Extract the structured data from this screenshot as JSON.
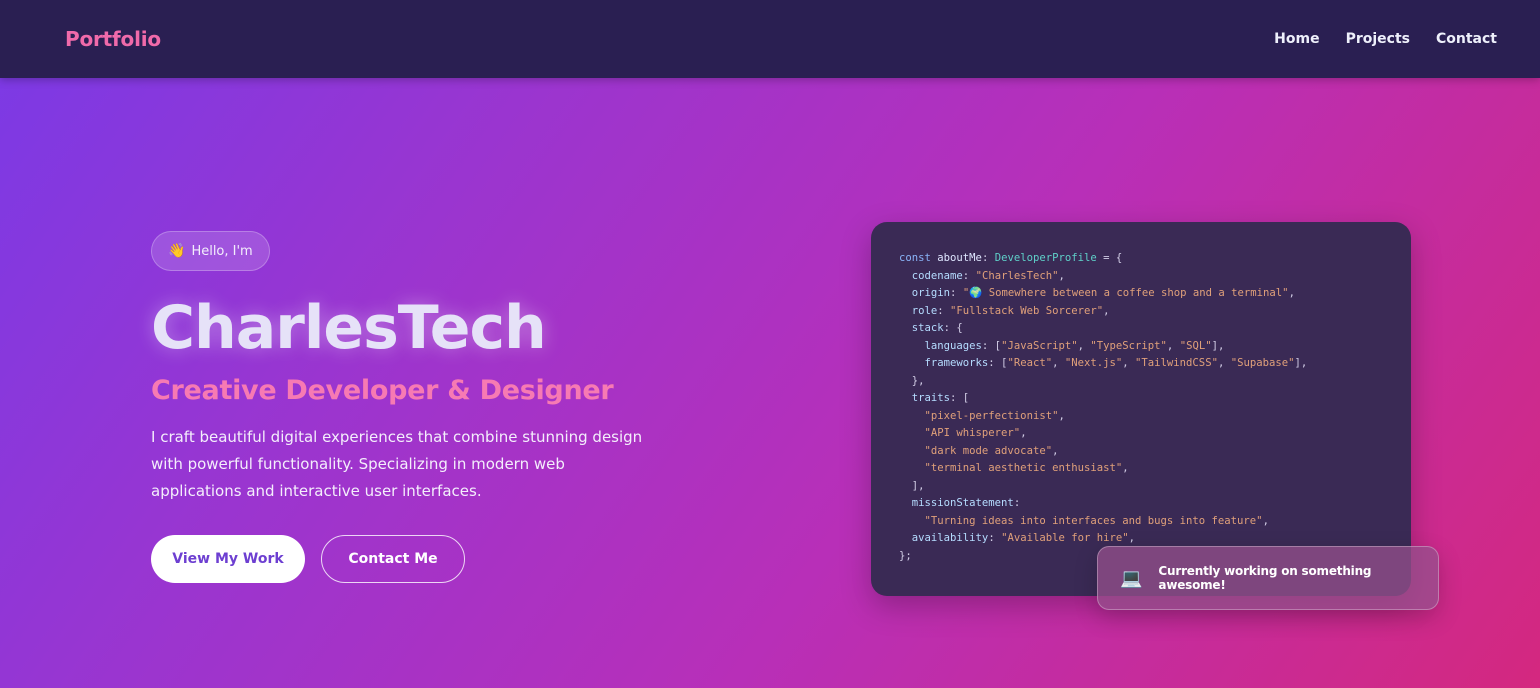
{
  "nav": {
    "logo": "Portfolio",
    "links": [
      {
        "label": "Home"
      },
      {
        "label": "Projects"
      },
      {
        "label": "Contact"
      }
    ]
  },
  "hero": {
    "greeting_icon": "👋",
    "greeting": "Hello, I'm",
    "name": "CharlesTech",
    "subtitle": "Creative Developer & Designer",
    "description": "I craft beautiful digital experiences that combine stunning design with powerful functionality. Specializing in modern web applications and interactive user interfaces.",
    "primary_button": "View My Work",
    "secondary_button": "Contact Me"
  },
  "code": {
    "line1": {
      "kw": "const",
      "id": "aboutMe",
      "ty": "DeveloperProfile",
      "end": " = {"
    },
    "codename": {
      "key": "codename",
      "value": "\"CharlesTech\""
    },
    "origin": {
      "key": "origin",
      "value_pre": "\"",
      "globe": "🌍",
      "value_post": " Somewhere between a coffee shop and a terminal\""
    },
    "role": {
      "key": "role",
      "value": "\"Fullstack Web Sorcerer\""
    },
    "stack": {
      "key": "stack"
    },
    "languages": {
      "key": "languages",
      "items": [
        "\"JavaScript\"",
        "\"TypeScript\"",
        "\"SQL\""
      ]
    },
    "frameworks": {
      "key": "frameworks",
      "items": [
        "\"React\"",
        "\"Next.js\"",
        "\"TailwindCSS\"",
        "\"Supabase\""
      ]
    },
    "traits": {
      "key": "traits",
      "items": [
        "\"pixel-perfectionist\"",
        "\"API whisperer\"",
        "\"dark mode advocate\"",
        "\"terminal aesthetic enthusiast\""
      ]
    },
    "mission": {
      "key": "missionStatement",
      "value": "\"Turning ideas into interfaces and bugs into feature\""
    },
    "availability": {
      "key": "availability",
      "value": "\"Available for hire\""
    }
  },
  "status": {
    "icon": "💻",
    "text": "Currently working on something awesome!"
  },
  "colors": {
    "logo": "#f06aaa",
    "navbar": "#2a1f52",
    "subtitle": "#f77ab3",
    "code_bg": "#3a2a55",
    "primary_button_text": "#6d3fd1"
  }
}
